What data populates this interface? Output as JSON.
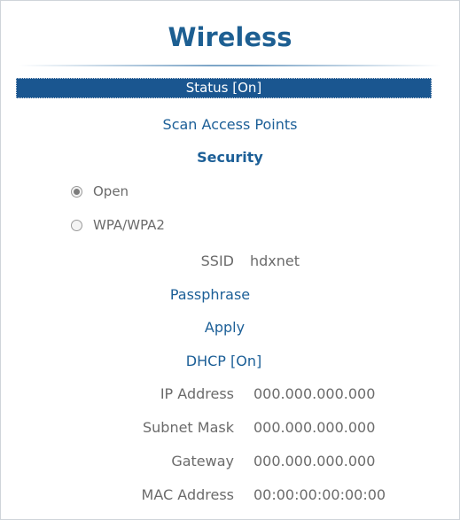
{
  "panel": {
    "title": "Wireless",
    "status": "Status [On]",
    "scan": "Scan Access Points",
    "security_heading": "Security",
    "security_options": [
      {
        "label": "Open",
        "selected": true
      },
      {
        "label": "WPA/WPA2",
        "selected": false
      }
    ],
    "ssid_label": "SSID",
    "ssid_value": "hdxnet",
    "passphrase": "Passphrase",
    "apply": "Apply",
    "dhcp": "DHCP [On]",
    "network_info": [
      {
        "label": "IP Address",
        "value": "000.000.000.000"
      },
      {
        "label": "Subnet Mask",
        "value": "000.000.000.000"
      },
      {
        "label": "Gateway",
        "value": "000.000.000.000"
      },
      {
        "label": "MAC Address",
        "value": "00:00:00:00:00:00"
      }
    ]
  },
  "colors": {
    "accent": "#1c5f97",
    "highlight_bg": "#1a5690",
    "muted_text": "#6b6b6b"
  }
}
